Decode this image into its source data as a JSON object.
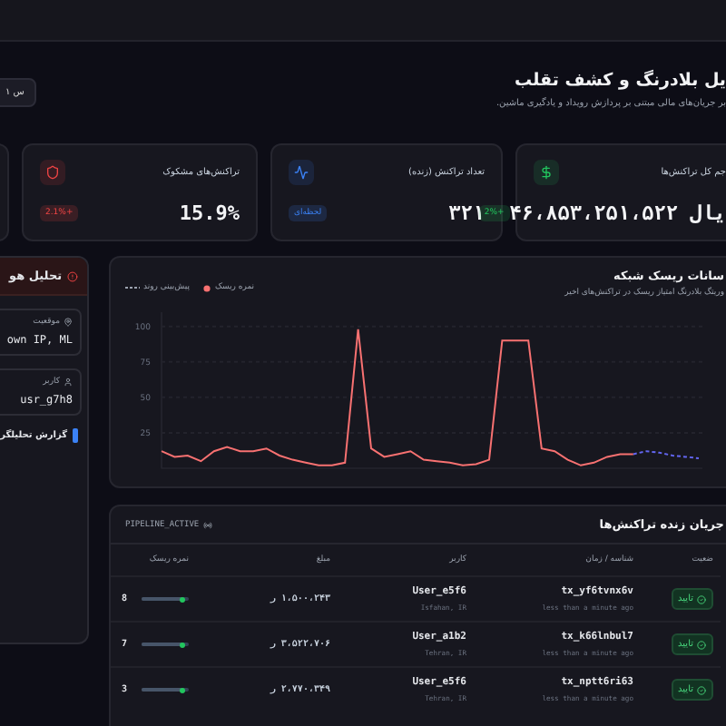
{
  "header": {
    "title": "یل بلادرنگ و کشف تقلب",
    "subtitle": "بر جریان‌های مالی مبتنی بر پردازش رویداد و یادگیری ماشین.",
    "range_button": "۱ س"
  },
  "stats": [
    {
      "label": "جم کل تراکنش‌ها",
      "value": "یال ۴۶،۸۵۳،۲۵۱،۵۲۲",
      "badge": "+2%",
      "color": "#22c55e"
    },
    {
      "label": "تعداد تراکنش (زنده)",
      "value": "۳۲۱",
      "badge": "لحظه‌ای",
      "color": "#3b82f6"
    },
    {
      "label": "تراکنش‌های مشکوک",
      "value": "15.9%",
      "badge": "+2.1%",
      "color": "#ef4444"
    }
  ],
  "analysis": {
    "title": "تحلیل هو",
    "fields": [
      {
        "label": "موقعیت",
        "value": "own IP, ML"
      },
      {
        "label": "کاربر",
        "value": "usr_g7h8"
      }
    ],
    "report": "گزارش تحلیلگر"
  },
  "chart": {
    "title": "سانات ریسک شبکه",
    "subtitle": "وریتگ بلادرنگ امتیاز ریسک در تراکنش‌های اخیر",
    "chart_data": {
      "type": "line",
      "grid": true,
      "ylim": [
        0,
        110
      ],
      "yticks": [
        25,
        50,
        75,
        100
      ],
      "series": [
        {
          "name": "پیش‌بینی روند",
          "color": "#6366f1",
          "line_style": "dashed",
          "values": [
            null,
            null,
            null,
            null,
            null,
            null,
            null,
            null,
            null,
            null,
            null,
            null,
            null,
            null,
            null,
            null,
            null,
            null,
            null,
            null,
            null,
            null,
            null,
            null,
            null,
            null,
            null,
            null,
            null,
            null,
            null,
            null,
            null,
            null,
            null,
            null,
            10,
            12,
            11,
            9,
            8,
            7
          ]
        },
        {
          "name": "نمره ریسک",
          "color": "#f87171",
          "line_style": "solid",
          "values": [
            12,
            8,
            9,
            5,
            12,
            15,
            12,
            12,
            14,
            9,
            6,
            4,
            2,
            2,
            4,
            98,
            14,
            8,
            10,
            12,
            6,
            5,
            4,
            2,
            3,
            6,
            90,
            90,
            90,
            14,
            12,
            6,
            2,
            4,
            8,
            10,
            10,
            null,
            null,
            null,
            null,
            null
          ]
        }
      ]
    }
  },
  "table": {
    "title": "جریان زنده تراکنش‌ها",
    "pipeline": "PIPELINE_ACTIVE",
    "columns": [
      "ضعیت",
      "شناسه / زمان",
      "کاربر",
      "مبلغ",
      "نمره ریسک"
    ],
    "rows": [
      {
        "status": "تایید",
        "id": "tx_yf6tvnx6v",
        "time": "less than a minute ago",
        "user": "User_e5f6",
        "city": "Isfahan, IR",
        "amount": "۱،۵۰۰،۲۴۳ ر",
        "score": "8"
      },
      {
        "status": "تایید",
        "id": "tx_k66lnbul7",
        "time": "less than a minute ago",
        "user": "User_a1b2",
        "city": "Tehran, IR",
        "amount": "۳،۵۲۲،۷۰۶ ر",
        "score": "7"
      },
      {
        "status": "تایید",
        "id": "tx_nptt6ri63",
        "time": "less than a minute ago",
        "user": "User_e5f6",
        "city": "Tehran, IR",
        "amount": "۲،۷۷۰،۳۴۹ ر",
        "score": "3"
      }
    ]
  }
}
